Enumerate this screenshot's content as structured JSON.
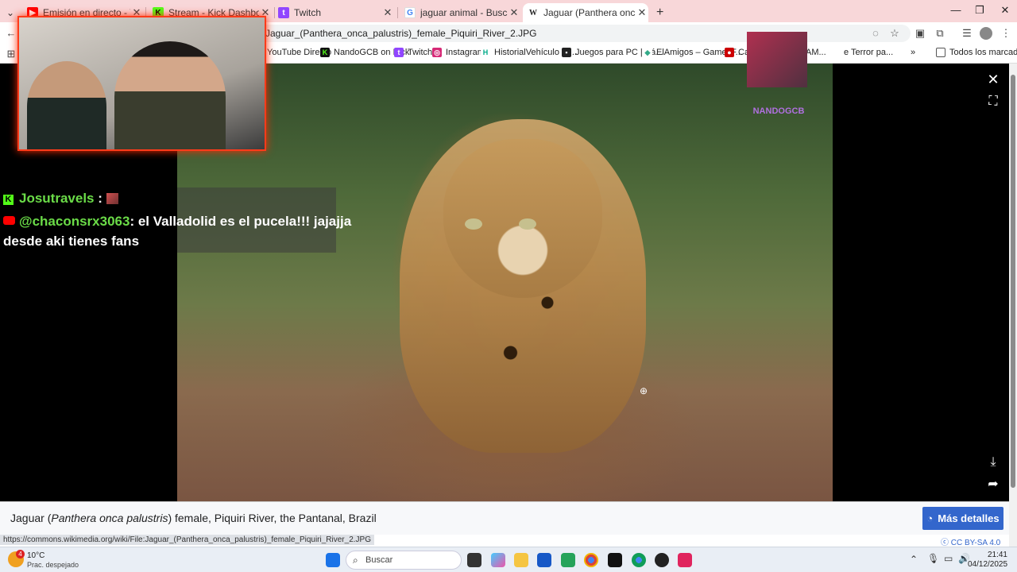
{
  "browser": {
    "tabs": [
      {
        "label": "Emisión en directo - YouTube St",
        "icon": "youtube-icon",
        "color": "#ff0000"
      },
      {
        "label": "Stream - Kick Dashboard",
        "icon": "kick-icon",
        "color": "#53fc18"
      },
      {
        "label": "Twitch",
        "icon": "twitch-icon",
        "color": "#9146ff"
      },
      {
        "label": "jaguar animal - Buscar con Goo",
        "icon": "google-icon",
        "color": "#4285f4"
      },
      {
        "label": "Jaguar (Panthera onca palustris",
        "icon": "wikipedia-icon",
        "color": "#333333",
        "active": true
      }
    ],
    "url": "Jaguar_(Panthera_onca_palustris)_female_Piquiri_River_2.JPG",
    "bookmarks": [
      {
        "label": "YouTube Directo",
        "icon": "youtube-icon"
      },
      {
        "label": "NandoGCB on Kick",
        "icon": "kick-icon"
      },
      {
        "label": "Twitch",
        "icon": "twitch-icon"
      },
      {
        "label": "Instagram",
        "icon": "instagram-icon"
      },
      {
        "label": "HistorialVehículo - I...",
        "icon": "bookmark-icon"
      },
      {
        "label": "Juegos para PC | Pá...",
        "icon": "bookmark-icon"
      },
      {
        "label": "ElAmigos – GamesF...",
        "icon": "bookmark-icon"
      },
      {
        "label": "Categorías - STEAM...",
        "icon": "bookmark-icon"
      },
      {
        "label": "e Terror pa...",
        "icon": "bookmark-icon"
      }
    ],
    "all_bookmarks_label": "Todos los marcadores"
  },
  "overlay": {
    "chat": [
      {
        "user": "Josutravels",
        "sep": ":",
        "platform": "kick"
      },
      {
        "user": "@chaconsrx3063",
        "message": ": el Valladolid es el pucela!!! jajajja",
        "message2": "desde aki tienes fans",
        "platform": "youtube"
      }
    ],
    "watermark": "NANDOGCB"
  },
  "viewer": {
    "caption_prefix": "Jaguar (",
    "caption_italic": "Panthera onca palustris",
    "caption_suffix": ") female, Piquiri River, the Pantanal, Brazil",
    "more_details": "Más detalles",
    "license": "CC BY-SA 4.0",
    "status_url": "https://commons.wikimedia.org/wiki/File:Jaguar_(Panthera_onca_palustris)_female_Piquiri_River_2.JPG"
  },
  "taskbar": {
    "weather_temp": "10°C",
    "weather_desc": "Prac. despejado",
    "weather_badge": "4",
    "search_placeholder": "Buscar",
    "time": "21:41",
    "date": "04/12/2025"
  }
}
